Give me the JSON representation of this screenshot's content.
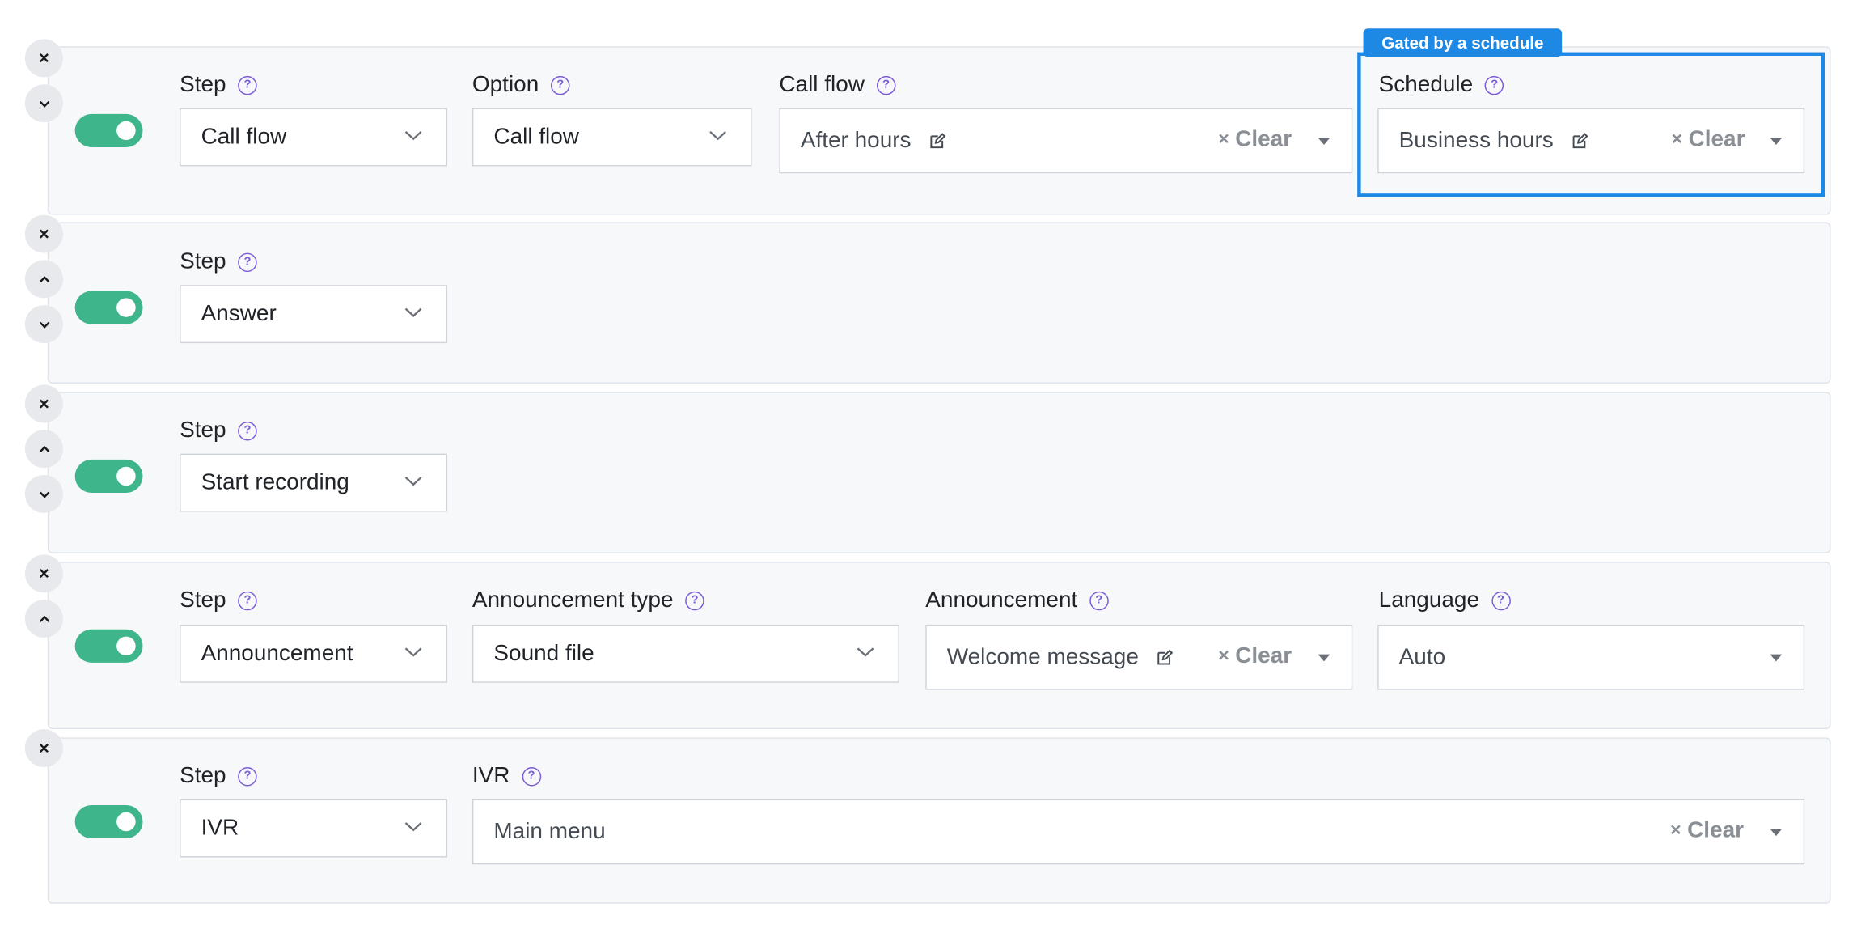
{
  "help_glyph": "?",
  "clear_x": "×",
  "highlight": {
    "badge": "Gated by a schedule"
  },
  "steps": [
    {
      "enabled": true,
      "controls": [
        "remove",
        "move-down"
      ],
      "step_label": "Step",
      "step_value": "Call flow",
      "option_label": "Option",
      "option_value": "Call flow",
      "callflow_label": "Call flow",
      "callflow_value": "After hours",
      "callflow_clear": "Clear",
      "schedule_label": "Schedule",
      "schedule_value": "Business hours",
      "schedule_clear": "Clear"
    },
    {
      "enabled": true,
      "controls": [
        "remove",
        "move-up",
        "move-down"
      ],
      "step_label": "Step",
      "step_value": "Answer"
    },
    {
      "enabled": true,
      "controls": [
        "remove",
        "move-up",
        "move-down"
      ],
      "step_label": "Step",
      "step_value": "Start recording"
    },
    {
      "enabled": true,
      "controls": [
        "remove",
        "move-up"
      ],
      "step_label": "Step",
      "step_value": "Announcement",
      "announcement_type_label": "Announcement type",
      "announcement_type_value": "Sound file",
      "announcement_label": "Announcement",
      "announcement_value": "Welcome message",
      "announcement_clear": "Clear",
      "language_label": "Language",
      "language_value": "Auto"
    },
    {
      "enabled": true,
      "controls": [
        "remove"
      ],
      "step_label": "Step",
      "step_value": "IVR",
      "ivr_label": "IVR",
      "ivr_value": "Main menu",
      "ivr_clear": "Clear"
    }
  ],
  "colors": {
    "toggle_on": "#3fb58b",
    "help_icon": "#7b5bd6",
    "highlight": "#1e88e5",
    "card_bg": "#f7f8fa",
    "card_border": "#dfe3ea"
  }
}
